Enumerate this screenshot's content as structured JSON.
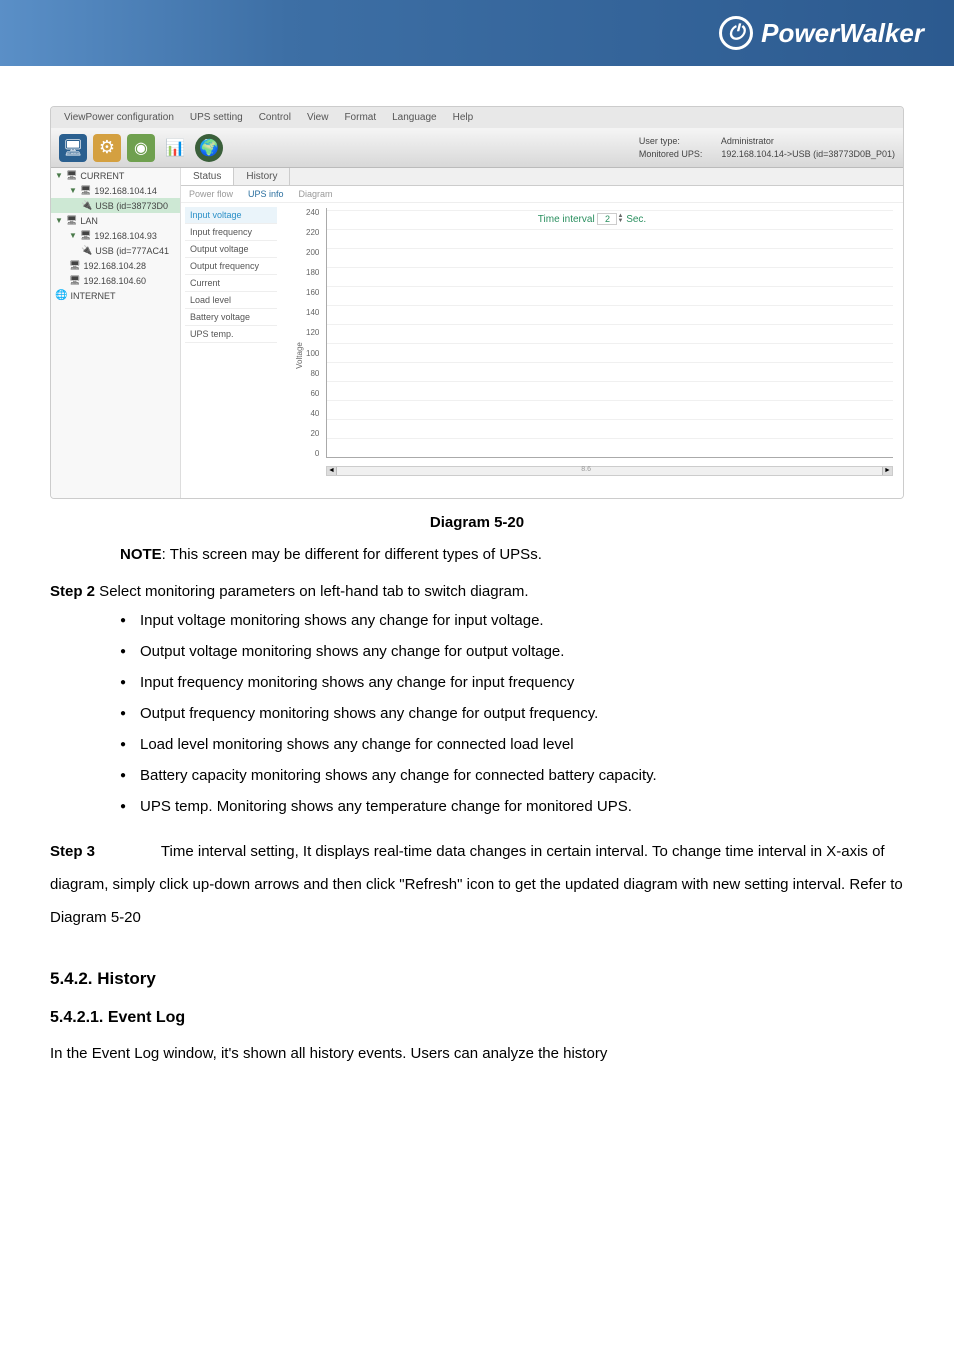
{
  "banner": {
    "brand": "PowerWalker"
  },
  "menubar": [
    "ViewPower configuration",
    "UPS setting",
    "Control",
    "View",
    "Format",
    "Language",
    "Help"
  ],
  "header": {
    "user_type_label": "User type:",
    "user_type": "Administrator",
    "monitored_label": "Monitored UPS:",
    "monitored": "192.168.104.14->USB (id=38773D0B_P01)"
  },
  "tree": {
    "current": "CURRENT",
    "ip1": "192.168.104.14",
    "usb1": "USB (id=38773D0",
    "lan": "LAN",
    "ip2": "192.168.104.93",
    "usb2": "USB (id=777AC41",
    "ip3": "192.168.104.28",
    "ip4": "192.168.104.60",
    "internet": "INTERNET"
  },
  "tabs": {
    "status": "Status",
    "history": "History"
  },
  "subtabs": {
    "powerflow": "Power flow",
    "upsinfo": "UPS info",
    "diagram": "Diagram"
  },
  "params": {
    "input_voltage": "Input voltage",
    "input_frequency": "Input frequency",
    "output_voltage": "Output voltage",
    "output_frequency": "Output frequency",
    "current": "Current",
    "load_level": "Load level",
    "battery_voltage": "Battery voltage",
    "ups_temp": "UPS temp."
  },
  "chart_data": {
    "type": "line",
    "title": "",
    "ylabel": "Voltage",
    "xlabel": "",
    "ylim": [
      0,
      240
    ],
    "y_ticks": [
      "240",
      "220",
      "200",
      "180",
      "160",
      "140",
      "120",
      "100",
      "80",
      "60",
      "40",
      "20",
      "0"
    ],
    "x_tick_visible": "8.6",
    "series": [
      {
        "name": "Input voltage",
        "values": []
      }
    ]
  },
  "time_interval": {
    "label": "Time interval",
    "value": "2",
    "unit": "Sec."
  },
  "caption": "Diagram 5-20",
  "note_label": "NOTE",
  "note_text": ": This screen may be different for different types of UPSs.",
  "step2_label": "Step 2",
  "step2_text": "  Select monitoring parameters on left-hand tab to switch diagram.",
  "bullets": [
    "Input voltage monitoring shows any change for input voltage.",
    "Output voltage monitoring shows any change for output voltage.",
    "Input frequency monitoring shows any change for input frequency",
    "Output frequency monitoring shows any change for output frequency.",
    "Load level monitoring shows any change for connected load level",
    "Battery capacity monitoring shows any change for connected battery capacity.",
    "UPS temp. Monitoring shows any temperature change for monitored UPS."
  ],
  "step3_label": "Step 3",
  "step3_text": " Time interval setting, It displays real-time data changes in certain interval. To change time interval in X-axis of diagram, simply click up-down arrows and then click \"Refresh\" icon to get the updated diagram with new setting interval. Refer to Diagram 5-20",
  "section_542": "5.4.2. History",
  "section_5421": "5.4.2.1.  Event Log",
  "paragraph_5421": "In the Event Log window, it's shown all history events. Users can analyze the history"
}
